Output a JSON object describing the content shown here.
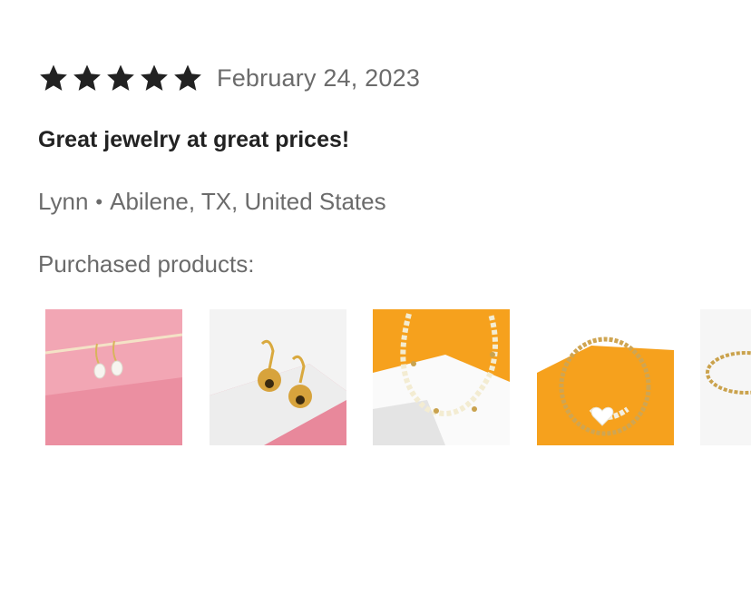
{
  "review": {
    "rating": 5,
    "rating_max": 5,
    "star_color": "#222222",
    "date": "February 24, 2023",
    "title": "Great jewelry at great prices!",
    "reviewer_name": "Lynn",
    "separator": "•",
    "reviewer_location": "Abilene, TX, United States",
    "purchased_label": "Purchased products:"
  },
  "products": [
    {
      "icon": "pearl-drop-earrings-image",
      "background": "#f1a9b6"
    },
    {
      "icon": "gold-ball-earrings-image",
      "background": "#ffffff"
    },
    {
      "icon": "pearl-gold-necklace-image",
      "background": "#f6a21c"
    },
    {
      "icon": "heart-pearl-bracelet-image",
      "background": "#f6a21c"
    },
    {
      "icon": "gold-bead-ring-image",
      "background": "#f5f5f5"
    }
  ]
}
